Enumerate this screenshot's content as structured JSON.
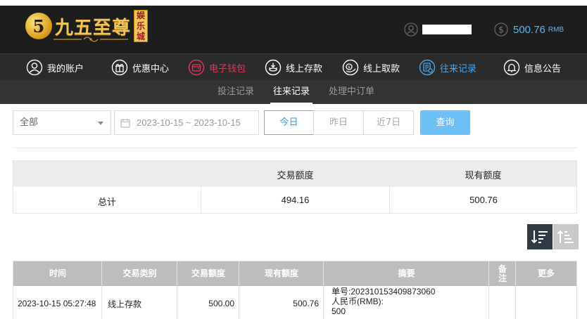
{
  "header": {
    "logo_mark": "5",
    "logo_text": "九五至尊",
    "logo_badge": "娱乐城",
    "balance": "500.76",
    "currency": "RMB",
    "colors": {
      "bg": "#1d1d1d",
      "accent_blue": "#5fb3ec",
      "logo_gold": "#f2c55a"
    }
  },
  "nav": {
    "items": [
      {
        "label": "我的账户",
        "icon": "user-circle-icon"
      },
      {
        "label": "优惠中心",
        "icon": "gift-icon"
      },
      {
        "label": "电子钱包",
        "icon": "wallet-icon"
      },
      {
        "label": "线上存款",
        "icon": "deposit-icon"
      },
      {
        "label": "线上取款",
        "icon": "withdraw-icon"
      },
      {
        "label": "往来记录",
        "icon": "records-icon"
      },
      {
        "label": "信息公告",
        "icon": "bell-icon"
      }
    ],
    "colors": {
      "wallet": "#e8345a",
      "records": "#48a7ee"
    }
  },
  "subnav": {
    "items": [
      {
        "label": "投注记录"
      },
      {
        "label": "往来记录"
      },
      {
        "label": "处理中订单"
      }
    ],
    "active": "往来记录"
  },
  "filter": {
    "type_selected": "全部",
    "date_range": "2023-10-15 ~ 2023-10-15",
    "segments": [
      "今日",
      "昨日",
      "近7日"
    ],
    "active_segment": "今日",
    "query_label": "查询"
  },
  "summary": {
    "headers": [
      "交易额度",
      "现有额度"
    ],
    "row_label": "总计",
    "amount": "494.16",
    "current": "500.76"
  },
  "table": {
    "headers": [
      "时间",
      "交易类别",
      "交易额度",
      "现有额度",
      "摘要",
      "备注",
      "更多"
    ],
    "rows": [
      {
        "time": "2023-10-15 05:27:48",
        "category": "线上存款",
        "amount": "500.00",
        "balance": "500.76",
        "summary_lines": [
          "单号:202310153409873060",
          "人民币(RMB):",
          "500"
        ],
        "note": "",
        "more": ""
      }
    ]
  }
}
